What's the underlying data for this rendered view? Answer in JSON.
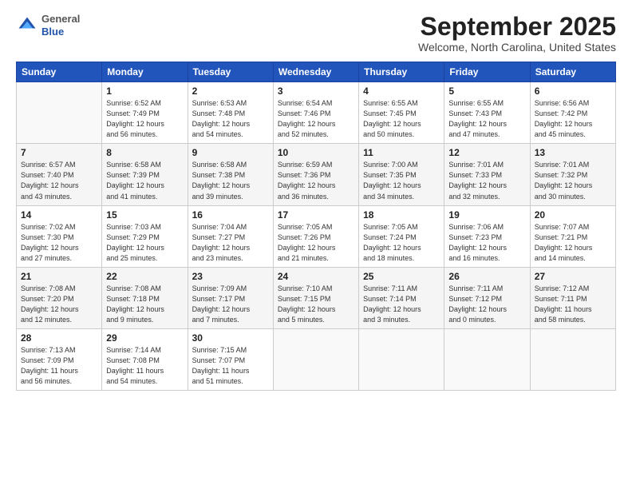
{
  "header": {
    "logo_general": "General",
    "logo_blue": "Blue",
    "month": "September 2025",
    "location": "Welcome, North Carolina, United States"
  },
  "days_of_week": [
    "Sunday",
    "Monday",
    "Tuesday",
    "Wednesday",
    "Thursday",
    "Friday",
    "Saturday"
  ],
  "weeks": [
    [
      {
        "num": "",
        "info": ""
      },
      {
        "num": "1",
        "info": "Sunrise: 6:52 AM\nSunset: 7:49 PM\nDaylight: 12 hours\nand 56 minutes."
      },
      {
        "num": "2",
        "info": "Sunrise: 6:53 AM\nSunset: 7:48 PM\nDaylight: 12 hours\nand 54 minutes."
      },
      {
        "num": "3",
        "info": "Sunrise: 6:54 AM\nSunset: 7:46 PM\nDaylight: 12 hours\nand 52 minutes."
      },
      {
        "num": "4",
        "info": "Sunrise: 6:55 AM\nSunset: 7:45 PM\nDaylight: 12 hours\nand 50 minutes."
      },
      {
        "num": "5",
        "info": "Sunrise: 6:55 AM\nSunset: 7:43 PM\nDaylight: 12 hours\nand 47 minutes."
      },
      {
        "num": "6",
        "info": "Sunrise: 6:56 AM\nSunset: 7:42 PM\nDaylight: 12 hours\nand 45 minutes."
      }
    ],
    [
      {
        "num": "7",
        "info": "Sunrise: 6:57 AM\nSunset: 7:40 PM\nDaylight: 12 hours\nand 43 minutes."
      },
      {
        "num": "8",
        "info": "Sunrise: 6:58 AM\nSunset: 7:39 PM\nDaylight: 12 hours\nand 41 minutes."
      },
      {
        "num": "9",
        "info": "Sunrise: 6:58 AM\nSunset: 7:38 PM\nDaylight: 12 hours\nand 39 minutes."
      },
      {
        "num": "10",
        "info": "Sunrise: 6:59 AM\nSunset: 7:36 PM\nDaylight: 12 hours\nand 36 minutes."
      },
      {
        "num": "11",
        "info": "Sunrise: 7:00 AM\nSunset: 7:35 PM\nDaylight: 12 hours\nand 34 minutes."
      },
      {
        "num": "12",
        "info": "Sunrise: 7:01 AM\nSunset: 7:33 PM\nDaylight: 12 hours\nand 32 minutes."
      },
      {
        "num": "13",
        "info": "Sunrise: 7:01 AM\nSunset: 7:32 PM\nDaylight: 12 hours\nand 30 minutes."
      }
    ],
    [
      {
        "num": "14",
        "info": "Sunrise: 7:02 AM\nSunset: 7:30 PM\nDaylight: 12 hours\nand 27 minutes."
      },
      {
        "num": "15",
        "info": "Sunrise: 7:03 AM\nSunset: 7:29 PM\nDaylight: 12 hours\nand 25 minutes."
      },
      {
        "num": "16",
        "info": "Sunrise: 7:04 AM\nSunset: 7:27 PM\nDaylight: 12 hours\nand 23 minutes."
      },
      {
        "num": "17",
        "info": "Sunrise: 7:05 AM\nSunset: 7:26 PM\nDaylight: 12 hours\nand 21 minutes."
      },
      {
        "num": "18",
        "info": "Sunrise: 7:05 AM\nSunset: 7:24 PM\nDaylight: 12 hours\nand 18 minutes."
      },
      {
        "num": "19",
        "info": "Sunrise: 7:06 AM\nSunset: 7:23 PM\nDaylight: 12 hours\nand 16 minutes."
      },
      {
        "num": "20",
        "info": "Sunrise: 7:07 AM\nSunset: 7:21 PM\nDaylight: 12 hours\nand 14 minutes."
      }
    ],
    [
      {
        "num": "21",
        "info": "Sunrise: 7:08 AM\nSunset: 7:20 PM\nDaylight: 12 hours\nand 12 minutes."
      },
      {
        "num": "22",
        "info": "Sunrise: 7:08 AM\nSunset: 7:18 PM\nDaylight: 12 hours\nand 9 minutes."
      },
      {
        "num": "23",
        "info": "Sunrise: 7:09 AM\nSunset: 7:17 PM\nDaylight: 12 hours\nand 7 minutes."
      },
      {
        "num": "24",
        "info": "Sunrise: 7:10 AM\nSunset: 7:15 PM\nDaylight: 12 hours\nand 5 minutes."
      },
      {
        "num": "25",
        "info": "Sunrise: 7:11 AM\nSunset: 7:14 PM\nDaylight: 12 hours\nand 3 minutes."
      },
      {
        "num": "26",
        "info": "Sunrise: 7:11 AM\nSunset: 7:12 PM\nDaylight: 12 hours\nand 0 minutes."
      },
      {
        "num": "27",
        "info": "Sunrise: 7:12 AM\nSunset: 7:11 PM\nDaylight: 11 hours\nand 58 minutes."
      }
    ],
    [
      {
        "num": "28",
        "info": "Sunrise: 7:13 AM\nSunset: 7:09 PM\nDaylight: 11 hours\nand 56 minutes."
      },
      {
        "num": "29",
        "info": "Sunrise: 7:14 AM\nSunset: 7:08 PM\nDaylight: 11 hours\nand 54 minutes."
      },
      {
        "num": "30",
        "info": "Sunrise: 7:15 AM\nSunset: 7:07 PM\nDaylight: 11 hours\nand 51 minutes."
      },
      {
        "num": "",
        "info": ""
      },
      {
        "num": "",
        "info": ""
      },
      {
        "num": "",
        "info": ""
      },
      {
        "num": "",
        "info": ""
      }
    ]
  ]
}
